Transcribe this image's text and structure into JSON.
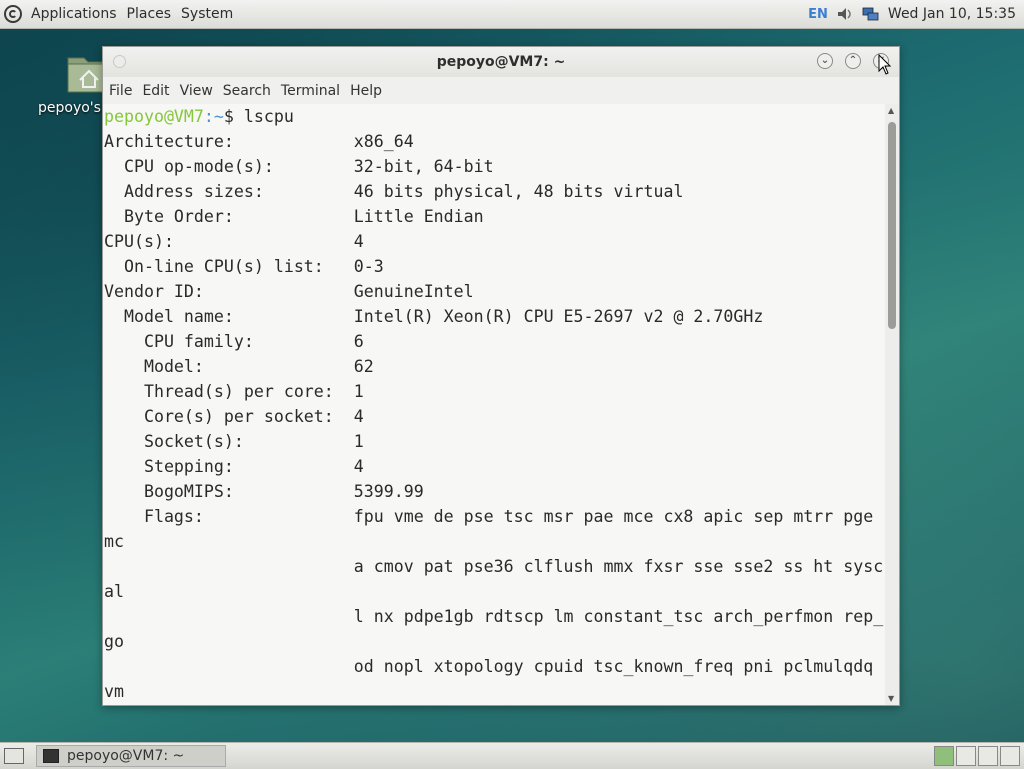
{
  "top_panel": {
    "menu": [
      "Applications",
      "Places",
      "System"
    ],
    "lang": "EN",
    "clock": "Wed Jan 10, 15:35"
  },
  "desktop": {
    "home_label": "pepoyo's Home"
  },
  "window": {
    "title": "pepoyo@VM7: ~",
    "menu": [
      "File",
      "Edit",
      "View",
      "Search",
      "Terminal",
      "Help"
    ]
  },
  "terminal": {
    "prompt_user": "pepoyo@VM7",
    "prompt_path": ":~",
    "prompt_end": "$ lscpu",
    "lines": [
      "Architecture:            x86_64",
      "  CPU op-mode(s):        32-bit, 64-bit",
      "  Address sizes:         46 bits physical, 48 bits virtual",
      "  Byte Order:            Little Endian",
      "CPU(s):                  4",
      "  On-line CPU(s) list:   0-3",
      "Vendor ID:               GenuineIntel",
      "  Model name:            Intel(R) Xeon(R) CPU E5-2697 v2 @ 2.70GHz",
      "    CPU family:          6",
      "    Model:               62",
      "    Thread(s) per core:  1",
      "    Core(s) per socket:  4",
      "    Socket(s):           1",
      "    Stepping:            4",
      "    BogoMIPS:            5399.99",
      "    Flags:               fpu vme de pse tsc msr pae mce cx8 apic sep mtrr pge",
      "mc",
      "                         a cmov pat pse36 clflush mmx fxsr sse sse2 ss ht sysc",
      "al",
      "                         l nx pdpe1gb rdtscp lm constant_tsc arch_perfmon rep_",
      "go",
      "                         od nopl xtopology cpuid tsc_known_freq pni pclmulqdq",
      "vm"
    ]
  },
  "taskbar": {
    "task_label": "pepoyo@VM7: ~"
  },
  "colors": {
    "prompt_user": "#84c73a",
    "prompt_path": "#4a90d9"
  }
}
